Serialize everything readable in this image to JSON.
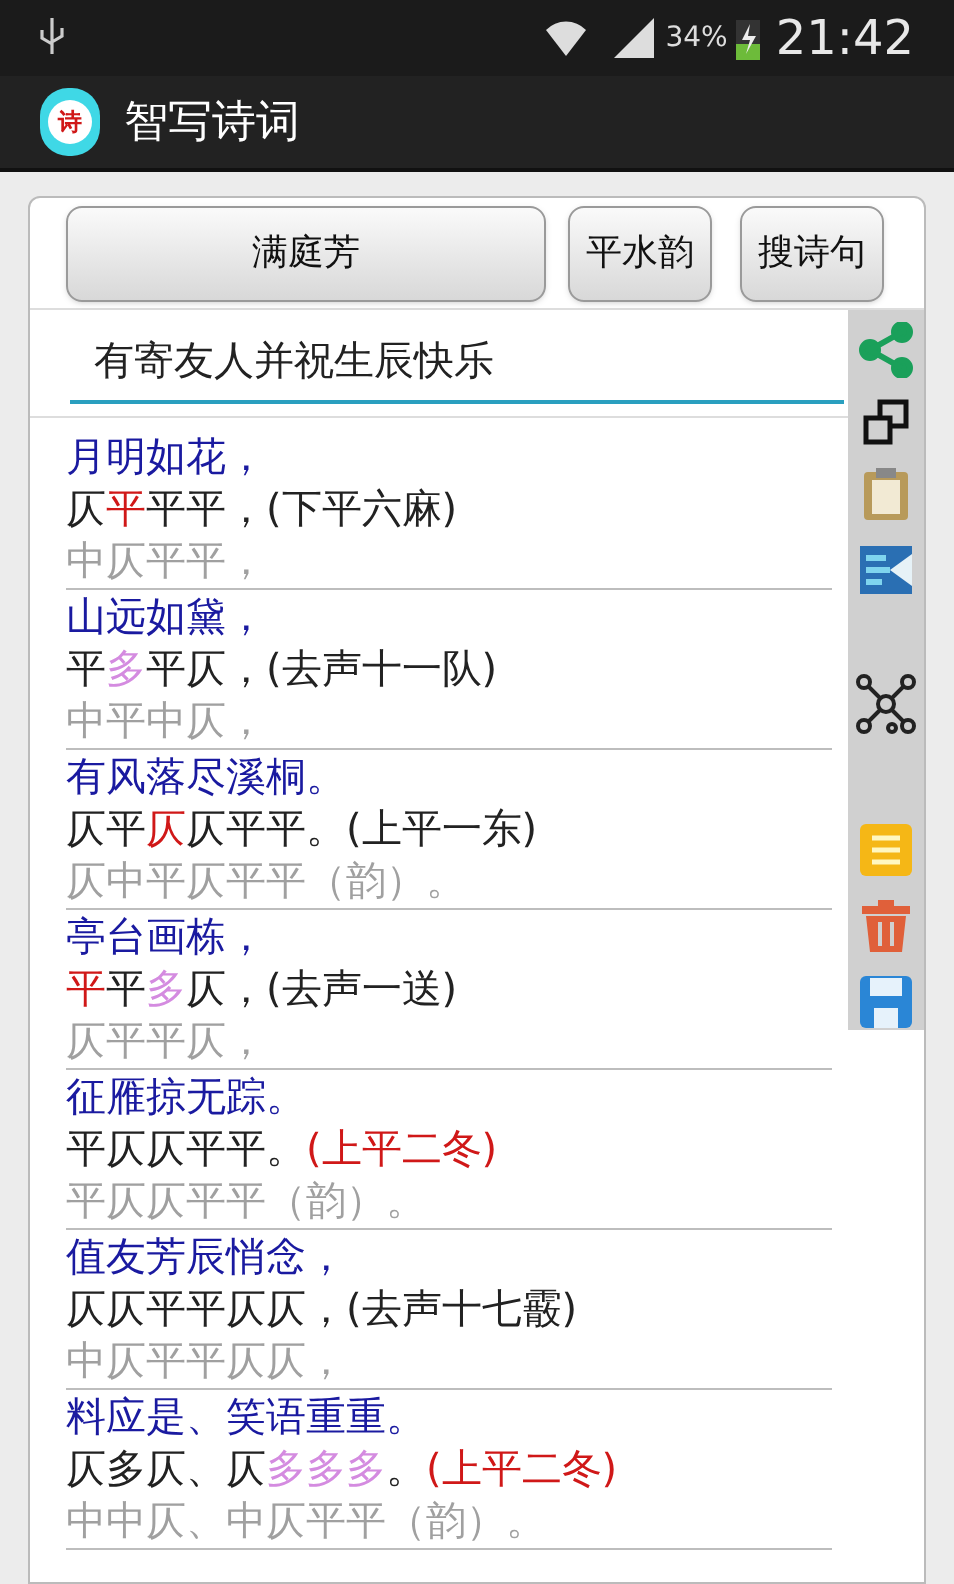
{
  "status_bar": {
    "battery": "34%",
    "time": "21:42"
  },
  "app_bar": {
    "title": "智写诗词",
    "icon_text": "诗"
  },
  "buttons": [
    {
      "label": "满庭芳",
      "kind": "wide"
    },
    {
      "label": "平水韵",
      "kind": "small"
    },
    {
      "label": "搜诗句",
      "kind": "small"
    }
  ],
  "input": {
    "value": "有寄友人并祝生辰快乐"
  },
  "stanzas": [
    {
      "verse": "月明如花，",
      "pattern": [
        {
          "text": "仄",
          "kind": "plain"
        },
        {
          "text": "平",
          "kind": "red"
        },
        {
          "text": "平平，(下平六麻)",
          "kind": "plain"
        }
      ],
      "reference": "中仄平平，"
    },
    {
      "verse": "山远如黛，",
      "pattern": [
        {
          "text": "平",
          "kind": "plain"
        },
        {
          "text": "多",
          "kind": "violet"
        },
        {
          "text": "平仄，(去声十一队)",
          "kind": "plain"
        }
      ],
      "reference": "中平中仄，"
    },
    {
      "verse": "有风落尽溪桐。",
      "pattern": [
        {
          "text": "仄平",
          "kind": "plain"
        },
        {
          "text": "仄",
          "kind": "red"
        },
        {
          "text": "仄平平。(上平一东)",
          "kind": "plain"
        }
      ],
      "reference": "仄中平仄平平（韵）。"
    },
    {
      "verse": "亭台画栋，",
      "pattern": [
        {
          "text": "平",
          "kind": "red"
        },
        {
          "text": "平",
          "kind": "plain"
        },
        {
          "text": "多",
          "kind": "violet"
        },
        {
          "text": "仄，(去声一送)",
          "kind": "plain"
        }
      ],
      "reference": "仄平平仄，"
    },
    {
      "verse": "征雁掠无踪。",
      "pattern": [
        {
          "text": "平仄仄平平。",
          "kind": "plain"
        },
        {
          "text": "(上平二冬)",
          "kind": "red"
        }
      ],
      "reference": "平仄仄平平（韵）。"
    },
    {
      "verse": "值友芳辰悄念，",
      "pattern": [
        {
          "text": "仄仄平平仄仄，(去声十七霰)",
          "kind": "plain"
        }
      ],
      "reference": "中仄平平仄仄，"
    },
    {
      "verse": "料应是、笑语重重。",
      "pattern": [
        {
          "text": "仄多仄、仄",
          "kind": "plain"
        },
        {
          "text": "多多多",
          "kind": "violet"
        },
        {
          "text": "。",
          "kind": "plain"
        },
        {
          "text": "(上平二冬)",
          "kind": "red"
        }
      ],
      "reference": "中中仄、中仄平平（韵）。"
    }
  ]
}
